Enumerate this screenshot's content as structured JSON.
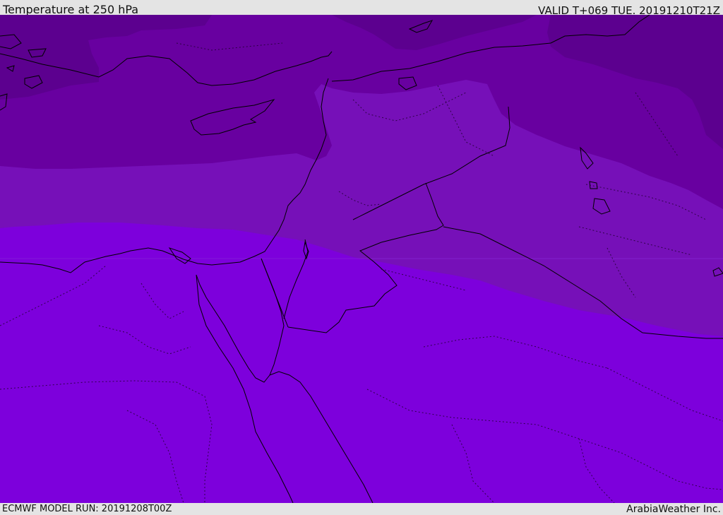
{
  "header": {
    "title": "Temperature at 250 hPa",
    "valid_time": "VALID T+069 TUE. 20191210T21Z"
  },
  "footer": {
    "model_run": "ECMWF MODEL RUN: 20191208T00Z",
    "credit": "ArabiaWeather Inc."
  },
  "colors": {
    "band_darkest": "#5c008f",
    "band_dark": "#6800a0",
    "band_mid": "#7610b8",
    "band_light": "#7d00dc",
    "coastline": "#000000",
    "border": "#000000"
  }
}
